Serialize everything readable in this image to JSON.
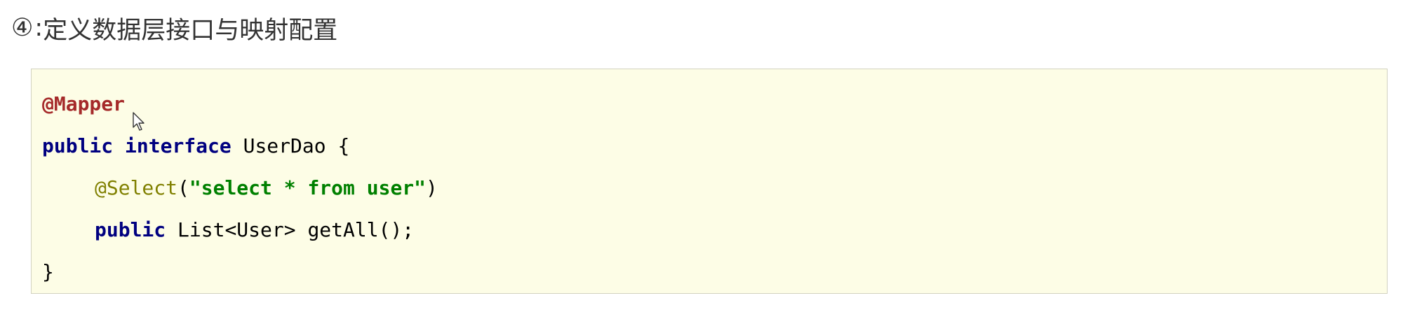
{
  "heading": {
    "marker": "④",
    "separator": ":",
    "text": "定义数据层接口与映射配置"
  },
  "code": {
    "line1": {
      "annotation": "@Mapper"
    },
    "line2": {
      "kw_public": "public",
      "kw_interface": "interface",
      "name": "UserDao {"
    },
    "line3": {
      "annotation": "@Select",
      "open": "(",
      "string": "\"select * from user\"",
      "close": ")"
    },
    "line4": {
      "kw_public": "public",
      "rest": "List<User> getAll();"
    },
    "line5": {
      "brace": "}"
    }
  }
}
